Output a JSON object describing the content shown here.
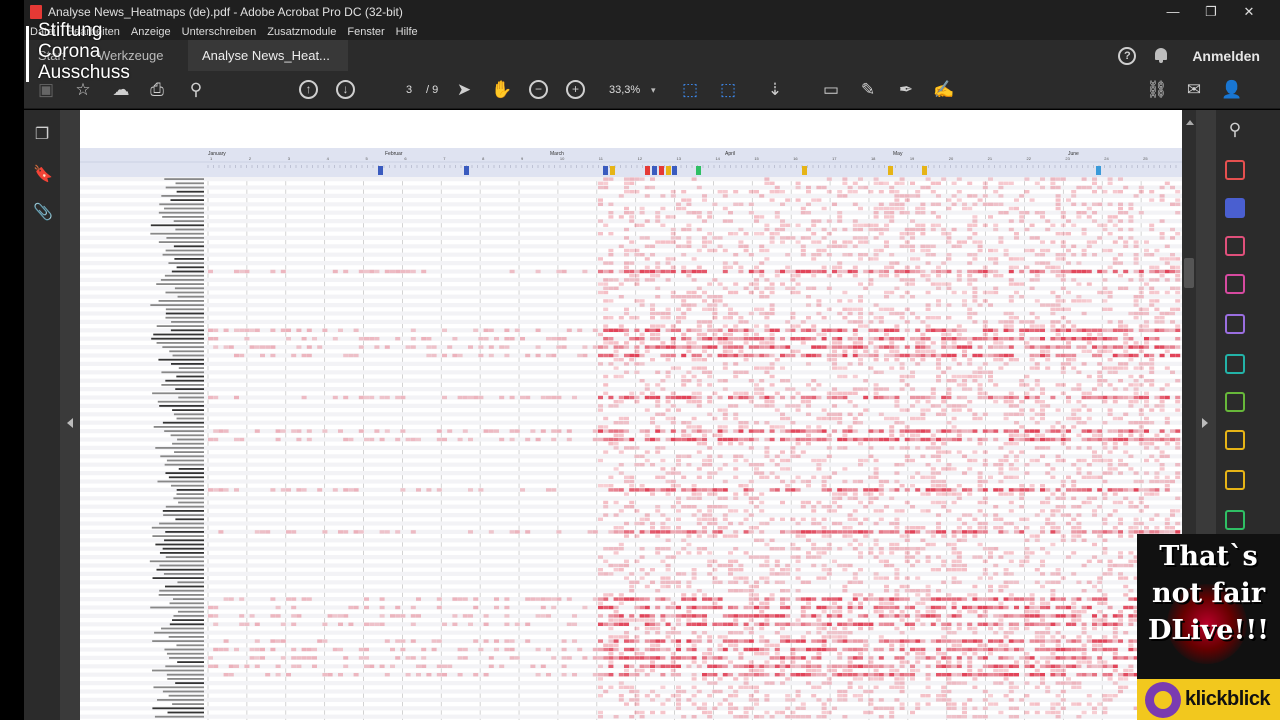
{
  "window": {
    "title": "Analyse News_Heatmaps (de).pdf - Adobe Acrobat Pro DC (32-bit)",
    "controls": [
      "—",
      "❐",
      "✕"
    ]
  },
  "menu": [
    "Datei",
    "Bearbeiten",
    "Anzeige",
    "Unterschreiben",
    "Zusatzmodule",
    "Fenster",
    "Hilfe"
  ],
  "tabs": {
    "home": "Start",
    "tools": "Werkzeuge",
    "document": "Analyse News_Heat...",
    "close": "×"
  },
  "header": {
    "help": "?",
    "signin": "Anmelden"
  },
  "toolbar": {
    "page_current": "3",
    "page_total": "/ 9",
    "zoom": "33,3%"
  },
  "heatmap": {
    "months": [
      "January",
      "Februar",
      "March",
      "April",
      "May",
      "June"
    ],
    "week_numbers": [
      "1",
      "2",
      "3",
      "4",
      "5",
      "6",
      "7",
      "8",
      "9",
      "10",
      "11",
      "12",
      "13",
      "14",
      "15",
      "16",
      "17",
      "18",
      "19",
      "20",
      "21",
      "22",
      "23",
      "24",
      "25"
    ],
    "row_labels_note": "illegible at this zoom level",
    "accent": "#e8505b"
  },
  "watermark": {
    "lines": [
      "Stiftung",
      "Corona",
      "Ausschuss"
    ]
  },
  "promo": {
    "lines": [
      "That`s",
      "not fair",
      "DLive!!!"
    ],
    "brand": "klickblick"
  }
}
